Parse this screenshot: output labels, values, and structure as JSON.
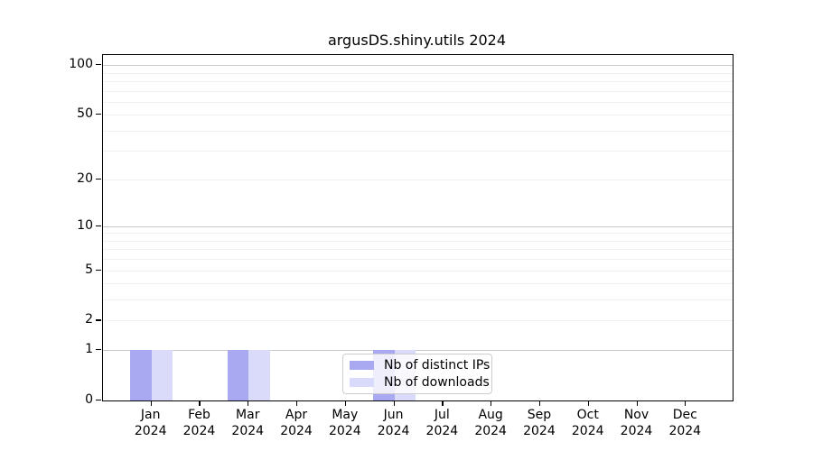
{
  "chart_data": {
    "type": "bar",
    "title": "argusDS.shiny.utils 2024",
    "x_categories": [
      "Jan",
      "Feb",
      "Mar",
      "Apr",
      "May",
      "Jun",
      "Jul",
      "Aug",
      "Sep",
      "Oct",
      "Nov",
      "Dec"
    ],
    "x_year": "2024",
    "series": [
      {
        "name": "Nb of distinct IPs",
        "color": "#a9a9f2",
        "values": [
          1,
          0,
          1,
          0,
          0,
          1,
          0,
          0,
          0,
          0,
          0,
          0
        ]
      },
      {
        "name": "Nb of downloads",
        "color": "#dadafa",
        "values": [
          1,
          0,
          1,
          0,
          0,
          1,
          0,
          0,
          0,
          0,
          0,
          0
        ]
      }
    ],
    "y_scale": "log1p",
    "y_axis_max": 115,
    "y_ticks": [
      0,
      1,
      2,
      5,
      10,
      20,
      50,
      100
    ],
    "y_major_gridlines": [
      1,
      10,
      100
    ],
    "y_minor_gridlines": [
      2,
      3,
      4,
      5,
      6,
      7,
      8,
      9,
      20,
      30,
      40,
      50,
      60,
      70,
      80,
      90
    ],
    "grid": true,
    "legend_position": "lower center"
  },
  "colors": {
    "background": "#ffffff",
    "spine": "#000000",
    "grid_major": "#c9c9c9",
    "grid_minor": "#f0f0f0",
    "distinct_ips": "#a9a9f2",
    "downloads": "#dadafa"
  }
}
